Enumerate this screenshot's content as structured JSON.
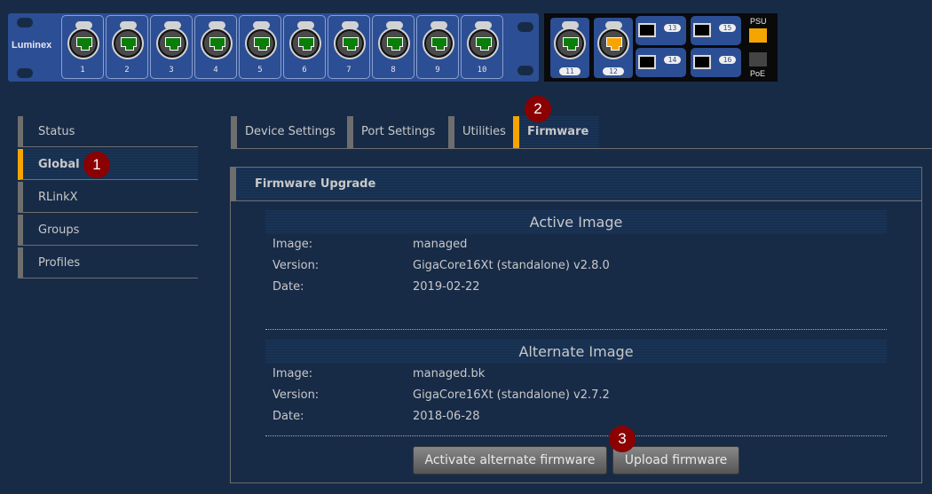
{
  "device": {
    "brand": "Luminex",
    "front_ports": [
      {
        "number": "1",
        "status": "green"
      },
      {
        "number": "2",
        "status": "green"
      },
      {
        "number": "3",
        "status": "green"
      },
      {
        "number": "4",
        "status": "green"
      },
      {
        "number": "5",
        "status": "green"
      },
      {
        "number": "6",
        "status": "green"
      },
      {
        "number": "7",
        "status": "green"
      },
      {
        "number": "8",
        "status": "green"
      },
      {
        "number": "9",
        "status": "green"
      },
      {
        "number": "10",
        "status": "green"
      }
    ],
    "rear_ports": [
      {
        "number": "11",
        "status": "green"
      },
      {
        "number": "12",
        "status": "orange"
      }
    ],
    "sfp_ports": [
      "13",
      "14",
      "15",
      "16"
    ],
    "psu_label": "PSU",
    "poe_label": "PoE",
    "colors": {
      "green": "#0a7d0a",
      "orange": "#f5a500",
      "psu": "#f5a500",
      "poe": "#444444"
    }
  },
  "sidebar": {
    "items": [
      {
        "label": "Status",
        "active": false
      },
      {
        "label": "Global",
        "active": true
      },
      {
        "label": "RLinkX",
        "active": false
      },
      {
        "label": "Groups",
        "active": false
      },
      {
        "label": "Profiles",
        "active": false
      }
    ]
  },
  "tabs": [
    {
      "label": "Device Settings",
      "active": false
    },
    {
      "label": "Port Settings",
      "active": false
    },
    {
      "label": "Utilities",
      "active": false
    },
    {
      "label": "Firmware",
      "active": true
    }
  ],
  "firmware": {
    "section_title": "Firmware Upgrade",
    "active": {
      "title": "Active Image",
      "image_label": "Image:",
      "image_value": "managed",
      "version_label": "Version:",
      "version_value": "GigaCore16Xt (standalone) v2.8.0",
      "date_label": "Date:",
      "date_value": "2019-02-22"
    },
    "alternate": {
      "title": "Alternate Image",
      "image_label": "Image:",
      "image_value": "managed.bk",
      "version_label": "Version:",
      "version_value": "GigaCore16Xt (standalone) v2.7.2",
      "date_label": "Date:",
      "date_value": "2018-06-28"
    },
    "buttons": {
      "activate": "Activate alternate firmware",
      "upload": "Upload firmware"
    }
  },
  "callouts": [
    "1",
    "2",
    "3"
  ],
  "accent_color": "#f5a500"
}
